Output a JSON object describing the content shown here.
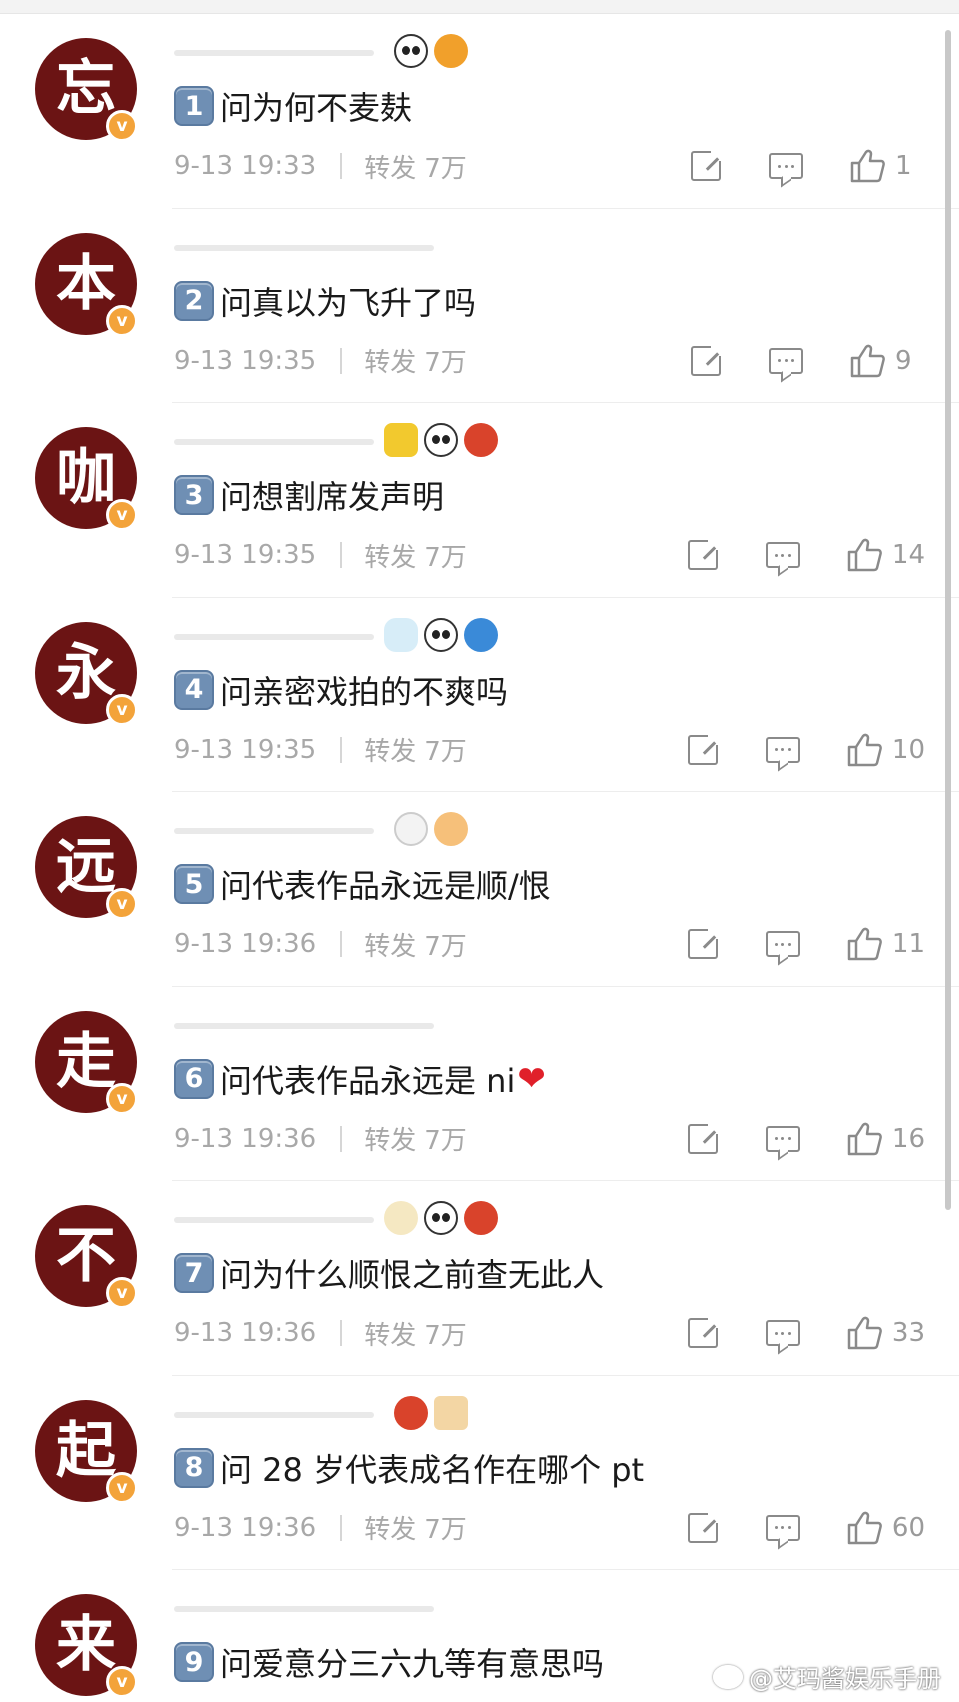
{
  "comments": [
    {
      "avatar_char": "忘",
      "num": "1",
      "text": "问为何不麦麸",
      "time": "9-13 19:33",
      "repost_label": "转发",
      "repost_count": "7万",
      "likes": "1",
      "emojis": [
        "panda",
        "fish"
      ]
    },
    {
      "avatar_char": "本",
      "num": "2",
      "text": "问真以为飞升了吗",
      "time": "9-13 19:35",
      "repost_label": "转发",
      "repost_count": "7万",
      "likes": "9",
      "emojis": []
    },
    {
      "avatar_char": "咖",
      "num": "3",
      "text": "问想割席发声明",
      "time": "9-13 19:35",
      "repost_label": "转发",
      "repost_count": "7万",
      "likes": "14",
      "emojis": [
        "gold",
        "panda",
        "bird"
      ]
    },
    {
      "avatar_char": "永",
      "num": "4",
      "text": "问亲密戏拍的不爽吗",
      "time": "9-13 19:35",
      "repost_label": "转发",
      "repost_count": "7万",
      "likes": "10",
      "emojis": [
        "cloud",
        "panda",
        "shield"
      ]
    },
    {
      "avatar_char": "远",
      "num": "5",
      "text": "问代表作品永远是顺/恨",
      "time": "9-13 19:36",
      "repost_label": "转发",
      "repost_count": "7万",
      "likes": "11",
      "emojis": [
        "face",
        "peach"
      ]
    },
    {
      "avatar_char": "走",
      "num": "6",
      "text": "问代表作品永远是 ni",
      "heart": "❤",
      "time": "9-13 19:36",
      "repost_label": "转发",
      "repost_count": "7万",
      "likes": "16",
      "emojis": []
    },
    {
      "avatar_char": "不",
      "num": "7",
      "text": "问为什么顺恨之前查无此人",
      "time": "9-13 19:36",
      "repost_label": "转发",
      "repost_count": "7万",
      "likes": "33",
      "emojis": [
        "cup",
        "panda",
        "bird"
      ]
    },
    {
      "avatar_char": "起",
      "num": "8",
      "text": "问 28 岁代表成名作在哪个 pt",
      "time": "9-13 19:36",
      "repost_label": "转发",
      "repost_count": "7万",
      "likes": "60",
      "emojis": [
        "bird",
        "box"
      ]
    },
    {
      "avatar_char": "来",
      "num": "9",
      "text": "问爱意分三六九等有意思吗",
      "emojis": []
    }
  ],
  "badge": "v",
  "watermark": "@艾玛酱娱乐手册",
  "colors": {
    "avatar_bg": "#6b1414",
    "badge": "#f3a33a",
    "num_box": "#6f8fb4",
    "meta_gray": "#a8a8a8"
  }
}
